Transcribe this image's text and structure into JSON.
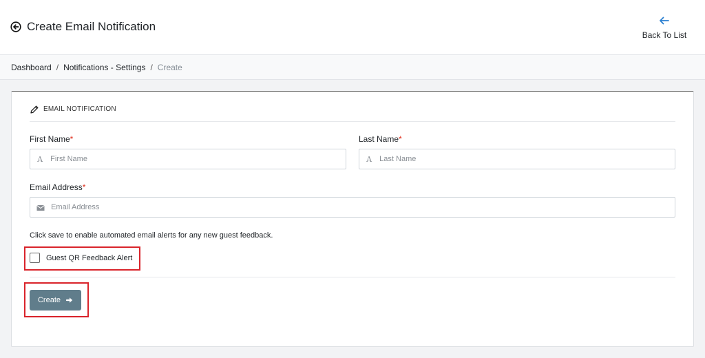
{
  "header": {
    "title": "Create Email Notification",
    "back_to_list": "Back To List",
    "accent_color": "#2b7fd1"
  },
  "breadcrumb": {
    "items": [
      "Dashboard",
      "Notifications - Settings",
      "Create"
    ],
    "separator": "/"
  },
  "card": {
    "title": "EMAIL NOTIFICATION",
    "first_name": {
      "label": "First Name",
      "required_mark": "*",
      "placeholder": "First Name",
      "value": ""
    },
    "last_name": {
      "label": "Last Name",
      "required_mark": "*",
      "placeholder": "Last Name",
      "value": ""
    },
    "email": {
      "label": "Email Address",
      "required_mark": "*",
      "placeholder": "Email Address",
      "value": ""
    },
    "text_icon_glyph": "A",
    "hint": "Click save to enable automated email alerts for any new guest feedback.",
    "checkbox": {
      "label": "Guest QR Feedback Alert",
      "checked": false
    },
    "create_button": {
      "label": "Create",
      "color": "#607d8b"
    },
    "highlight_color": "#d9232a"
  }
}
